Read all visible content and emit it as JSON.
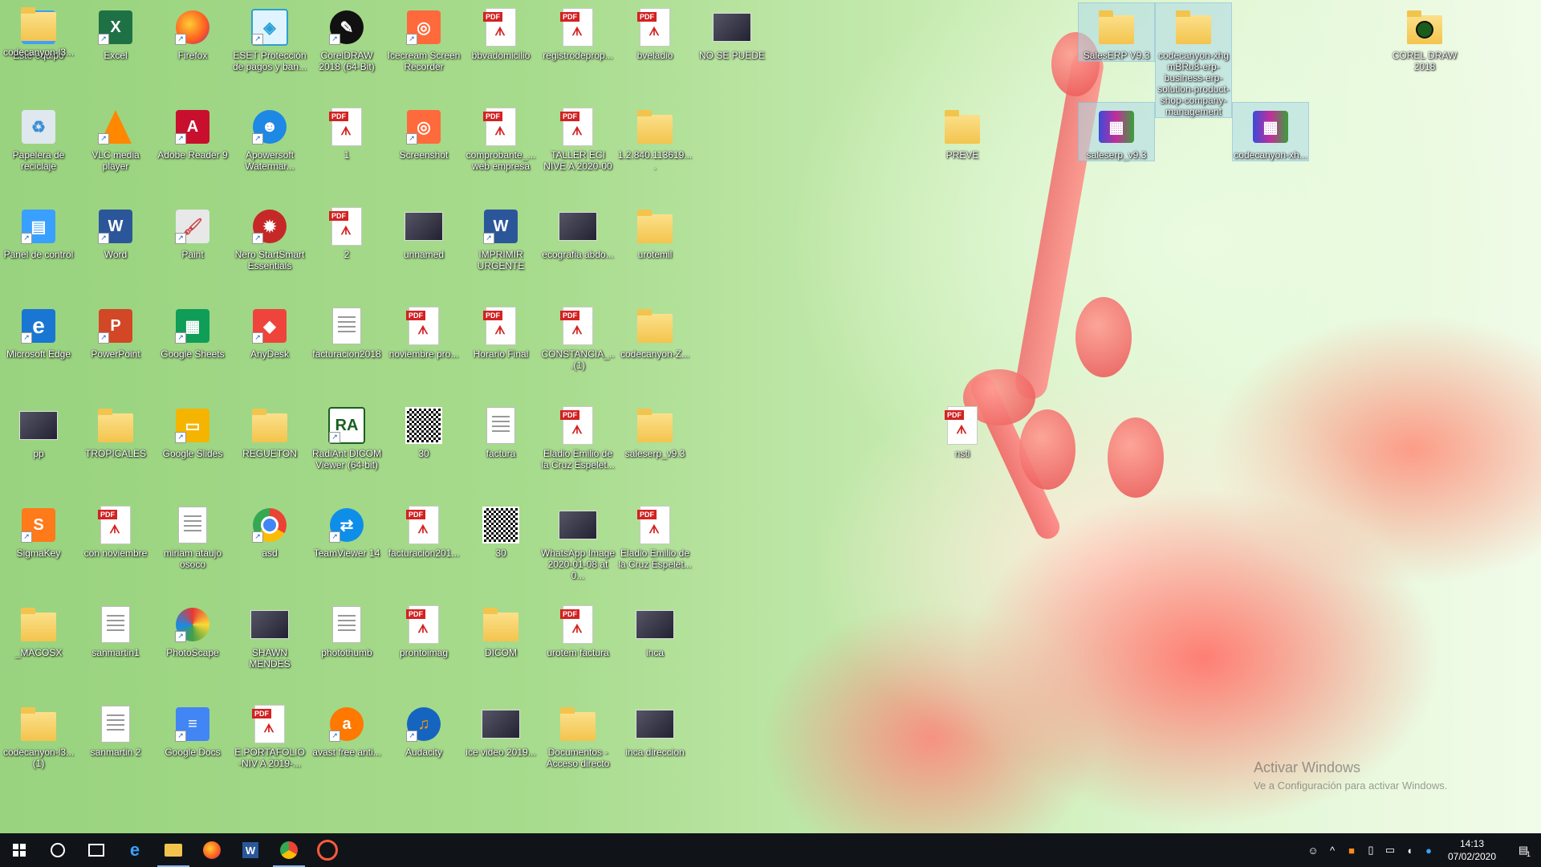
{
  "desktop": {
    "icons": [
      {
        "label": "Este equipo",
        "type": "pc"
      },
      {
        "label": "Excel",
        "type": "excel"
      },
      {
        "label": "Firefox",
        "type": "firefox"
      },
      {
        "label": "ESET Protección de pagos y ban...",
        "type": "eset"
      },
      {
        "label": "CorelDRAW 2018 (64-Bit)",
        "type": "corel"
      },
      {
        "label": "Icecream Screen Recorder",
        "type": "icecream"
      },
      {
        "label": "bbvadomicilio",
        "type": "pdf"
      },
      {
        "label": "registrodeprop...",
        "type": "pdf"
      },
      {
        "label": "bveladio",
        "type": "pdf"
      },
      {
        "label": "NO SE PUEDE",
        "type": "photo"
      },
      {
        "label": "Papelera de reciclaje",
        "type": "bin"
      },
      {
        "label": "VLC media player",
        "type": "vlc"
      },
      {
        "label": "Adobe Reader 9",
        "type": "adobe"
      },
      {
        "label": "Apowersoft Watermar...",
        "type": "apower"
      },
      {
        "label": "1",
        "type": "pdf"
      },
      {
        "label": "Screenshot",
        "type": "icecream"
      },
      {
        "label": "comprobante_...web empresa",
        "type": "pdf"
      },
      {
        "label": "TALLER ECI NIVE A 2020-00",
        "type": "pdf"
      },
      {
        "label": "1.2.840.113619....",
        "type": "folder"
      },
      {
        "label": "Panel de control",
        "type": "panel"
      },
      {
        "label": "Word",
        "type": "word"
      },
      {
        "label": "Paint",
        "type": "paint"
      },
      {
        "label": "Nero StartSmart Essentials",
        "type": "nero"
      },
      {
        "label": "2",
        "type": "pdf"
      },
      {
        "label": "unnamed",
        "type": "photo"
      },
      {
        "label": "IMPRIMIR URGENTE",
        "type": "word"
      },
      {
        "label": "ecografia abdo...",
        "type": "photo"
      },
      {
        "label": "urotemil",
        "type": "folder"
      },
      {
        "label": "Microsoft Edge",
        "type": "edge"
      },
      {
        "label": "PowerPoint",
        "type": "ppt"
      },
      {
        "label": "Google Sheets",
        "type": "sheets"
      },
      {
        "label": "AnyDesk",
        "type": "anydesk"
      },
      {
        "label": "facturacion2018",
        "type": "doc"
      },
      {
        "label": "noviembre pro...",
        "type": "pdf"
      },
      {
        "label": "Horario Final",
        "type": "pdf"
      },
      {
        "label": "CONSTANCIA_...(1)",
        "type": "pdf"
      },
      {
        "label": "codecanyon-Z...",
        "type": "folder"
      },
      {
        "label": "pp",
        "type": "photo"
      },
      {
        "label": "TROPICALES",
        "type": "folder"
      },
      {
        "label": "Google Slides",
        "type": "slides"
      },
      {
        "label": "REGUETON",
        "type": "folder"
      },
      {
        "label": "RadiAnt DICOM Viewer (64-bit)",
        "type": "radiant"
      },
      {
        "label": "30",
        "type": "qr"
      },
      {
        "label": "factura",
        "type": "doc"
      },
      {
        "label": "Eladio Emilio de la Cruz Espelet...",
        "type": "pdf"
      },
      {
        "label": "saleserp_v9.3",
        "type": "folder"
      },
      {
        "label": "SigmaKey",
        "type": "sigma"
      },
      {
        "label": "con noviembre",
        "type": "pdf"
      },
      {
        "label": "miriam ataujo osoco",
        "type": "doc"
      },
      {
        "label": "asd",
        "type": "chrome"
      },
      {
        "label": "TeamViewer 14",
        "type": "teamviewer"
      },
      {
        "label": "facturacion201...",
        "type": "pdf"
      },
      {
        "label": "30",
        "type": "qr"
      },
      {
        "label": "WhatsApp Image 2020-01-08 at 0...",
        "type": "photo"
      },
      {
        "label": "Eladio Emilio de la Cruz Espelet...",
        "type": "pdf"
      },
      {
        "label": "_MACOSX",
        "type": "folder"
      },
      {
        "label": "sanmartin1",
        "type": "doc"
      },
      {
        "label": "PhotoScape",
        "type": "photoscape"
      },
      {
        "label": "SHAWN MENDES",
        "type": "photo"
      },
      {
        "label": "photothumb",
        "type": "doc"
      },
      {
        "label": "prontoimag",
        "type": "pdf"
      },
      {
        "label": "DICOM",
        "type": "folder"
      },
      {
        "label": "urotem factura",
        "type": "pdf"
      },
      {
        "label": "inca",
        "type": "photo"
      },
      {
        "label": "codecanyon-l3...(1)",
        "type": "folder"
      },
      {
        "label": "sanmartin 2",
        "type": "doc"
      },
      {
        "label": "Google Docs",
        "type": "docs"
      },
      {
        "label": "E.PORTAFOLIO -NIV A 2019-...",
        "type": "pdf"
      },
      {
        "label": "avast free anti...",
        "type": "avast"
      },
      {
        "label": "Audacity",
        "type": "audacity"
      },
      {
        "label": "ice video 2019...",
        "type": "photo"
      },
      {
        "label": "Documentos - Acceso directo",
        "type": "folder"
      },
      {
        "label": "inca direccion",
        "type": "photo"
      },
      {
        "label": "codecanyon-l3...",
        "type": "folder"
      }
    ],
    "right_icons": [
      {
        "label": "SalesERP V9.3",
        "type": "folder",
        "selected": true
      },
      {
        "label": "codecanyon-xhg mBRu8-erp-business-erp-solution-product-shop-company-management",
        "type": "folder",
        "selected": true
      },
      {
        "label": "COREL DRAW 2018",
        "type": "corelfolder",
        "selected": false
      },
      {
        "label": "PREVE",
        "type": "folder",
        "selected": false
      },
      {
        "label": "saleserp_v9.3",
        "type": "rar",
        "selected": true
      },
      {
        "label": "codecanyon-xh...",
        "type": "rar",
        "selected": true
      },
      {
        "label": "nsti",
        "type": "pdf",
        "selected": false
      }
    ]
  },
  "watermark": {
    "title": "Activar Windows",
    "subtitle": "Ve a Configuración para activar Windows."
  },
  "taskbar": {
    "items": [
      "start",
      "search",
      "taskview",
      "edge",
      "explorer",
      "firefox",
      "word",
      "chrome",
      "screenrec"
    ],
    "clock_time": "14:13",
    "clock_date": "07/02/2020",
    "notification_count": "1"
  },
  "colors": {
    "taskbar": "#101418",
    "accent": "#8ab4f8"
  }
}
